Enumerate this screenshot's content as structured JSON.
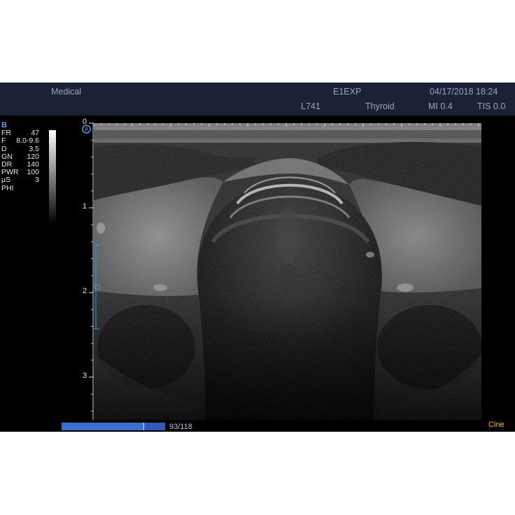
{
  "header": {
    "institution": "Medical",
    "preset_code": "E1EXP",
    "datetime": "04/17/2018 18:24",
    "probe": "L741",
    "exam": "Thyroid",
    "mi": "MI 0.4",
    "tis": "TIS 0.0"
  },
  "params": {
    "mode": "B",
    "rows": [
      {
        "label": "FR",
        "value": "47"
      },
      {
        "label": "F",
        "value": "8.0-9.6"
      },
      {
        "label": "D",
        "value": "3.5"
      },
      {
        "label": "GN",
        "value": "120"
      },
      {
        "label": "DR",
        "value": "140"
      },
      {
        "label": "PWR",
        "value": "100"
      },
      {
        "label": "µS",
        "value": "3"
      },
      {
        "label": "PHI",
        "value": ""
      }
    ]
  },
  "depth_scale": {
    "labels": [
      "0",
      "1",
      "2",
      "3"
    ]
  },
  "cine": {
    "frame_label": "93/118",
    "current": 93,
    "total": 118,
    "label": "Cine"
  },
  "colors": {
    "topbar": "#1b2236",
    "accent_blue": "#5aa0e6",
    "cine_yellow": "#f2c200"
  }
}
